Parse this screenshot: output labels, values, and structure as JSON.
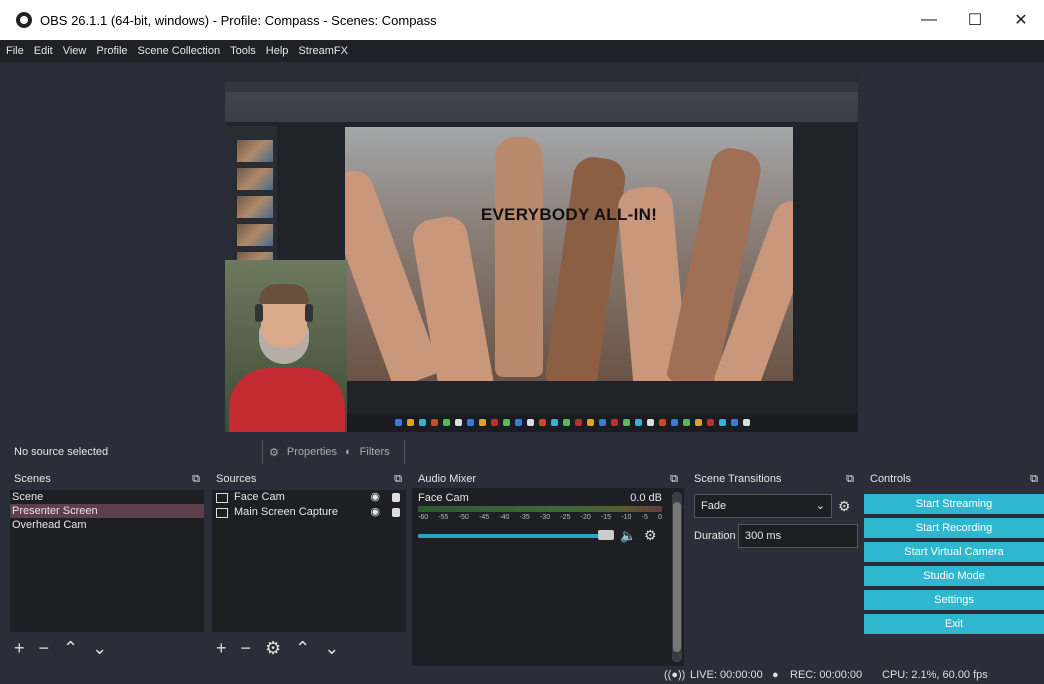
{
  "window": {
    "title": "OBS 26.1.1 (64-bit, windows) - Profile: Compass - Scenes: Compass"
  },
  "titlebar_buttons": {
    "minimize": "—",
    "maximize": "☐",
    "close": "✕"
  },
  "menu": [
    "File",
    "Edit",
    "View",
    "Profile",
    "Scene Collection",
    "Tools",
    "Help",
    "StreamFX"
  ],
  "preview": {
    "slide_text": "EVERYBODY ALL-IN!"
  },
  "status": {
    "no_source": "No source selected",
    "properties": "Properties",
    "filters": "Filters"
  },
  "scenes": {
    "header": "Scenes",
    "items": [
      "Scene",
      "Presenter Screen",
      "Overhead Cam"
    ],
    "selected": "Presenter Screen"
  },
  "sources": {
    "header": "Sources",
    "items": [
      "Face Cam",
      "Main Screen Capture"
    ]
  },
  "mixer": {
    "header": "Audio Mixer",
    "source": "Face Cam",
    "level": "0.0 dB",
    "ticks": [
      "-60",
      "-55",
      "-50",
      "-45",
      "-40",
      "-35",
      "-30",
      "-25",
      "-20",
      "-15",
      "-10",
      "-5",
      "0"
    ]
  },
  "transitions": {
    "header": "Scene Transitions",
    "selected": "Fade",
    "duration_label": "Duration",
    "duration_value": "300 ms"
  },
  "controls": {
    "header": "Controls",
    "buttons": [
      "Start Streaming",
      "Start Recording",
      "Start Virtual Camera",
      "Studio Mode",
      "Settings",
      "Exit"
    ]
  },
  "statusbar": {
    "live": "LIVE: 00:00:00",
    "rec": "REC: 00:00:00",
    "cpu": "CPU: 2.1%, 60.00 fps"
  },
  "colors": {
    "accent": "#2fb7cf",
    "selected_scene": "#5d3f4d",
    "background": "#2b2e38"
  }
}
